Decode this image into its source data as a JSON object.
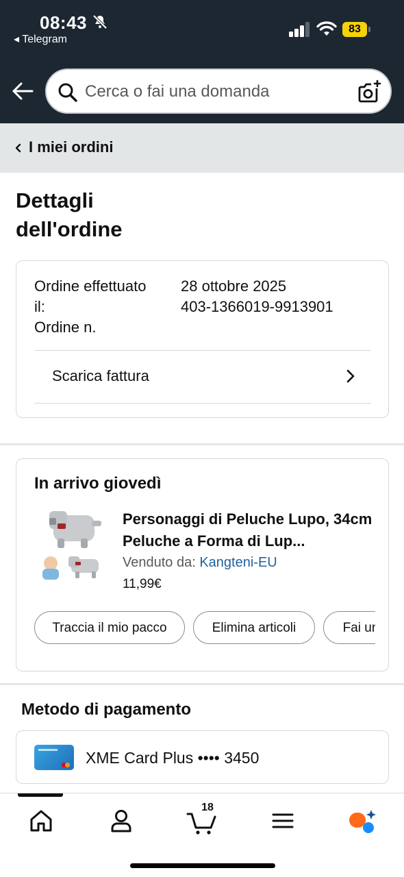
{
  "status_bar": {
    "time": "08:43",
    "back_app": "◂ Telegram",
    "battery": "83"
  },
  "header": {
    "search_placeholder": "Cerca o fai una domanda"
  },
  "breadcrumb": {
    "label": "I miei ordini"
  },
  "page": {
    "title": "Dettagli dell'ordine"
  },
  "order": {
    "placed_label": "Ordine effettuato il:",
    "placed_value": "28 ottobre 2025",
    "number_label": "Ordine n.",
    "number_value": "403-1366019-9913901",
    "invoice_label": "Scarica fattura"
  },
  "delivery": {
    "title": "In arrivo giovedì",
    "product_name": "Personaggi di Peluche Lupo, 34cm Peluche a Forma di Lup...",
    "sold_by_label": "Venduto da: ",
    "seller": "Kangteni-EU",
    "price": "11,99€",
    "actions": [
      "Traccia il mio pacco",
      "Elimina articoli",
      "Fai un"
    ]
  },
  "payment": {
    "title": "Metodo di pagamento",
    "card": "XME Card Plus •••• 3450"
  },
  "bottom_nav": {
    "cart_count": "18",
    "items": [
      "home-icon",
      "account-icon",
      "cart-icon",
      "menu-icon",
      "rufus-icon"
    ]
  },
  "colors": {
    "header_bg": "#1d2732",
    "crumb_bg": "#e3e6e6",
    "link": "#2162a1",
    "battery": "#f5d20a"
  }
}
